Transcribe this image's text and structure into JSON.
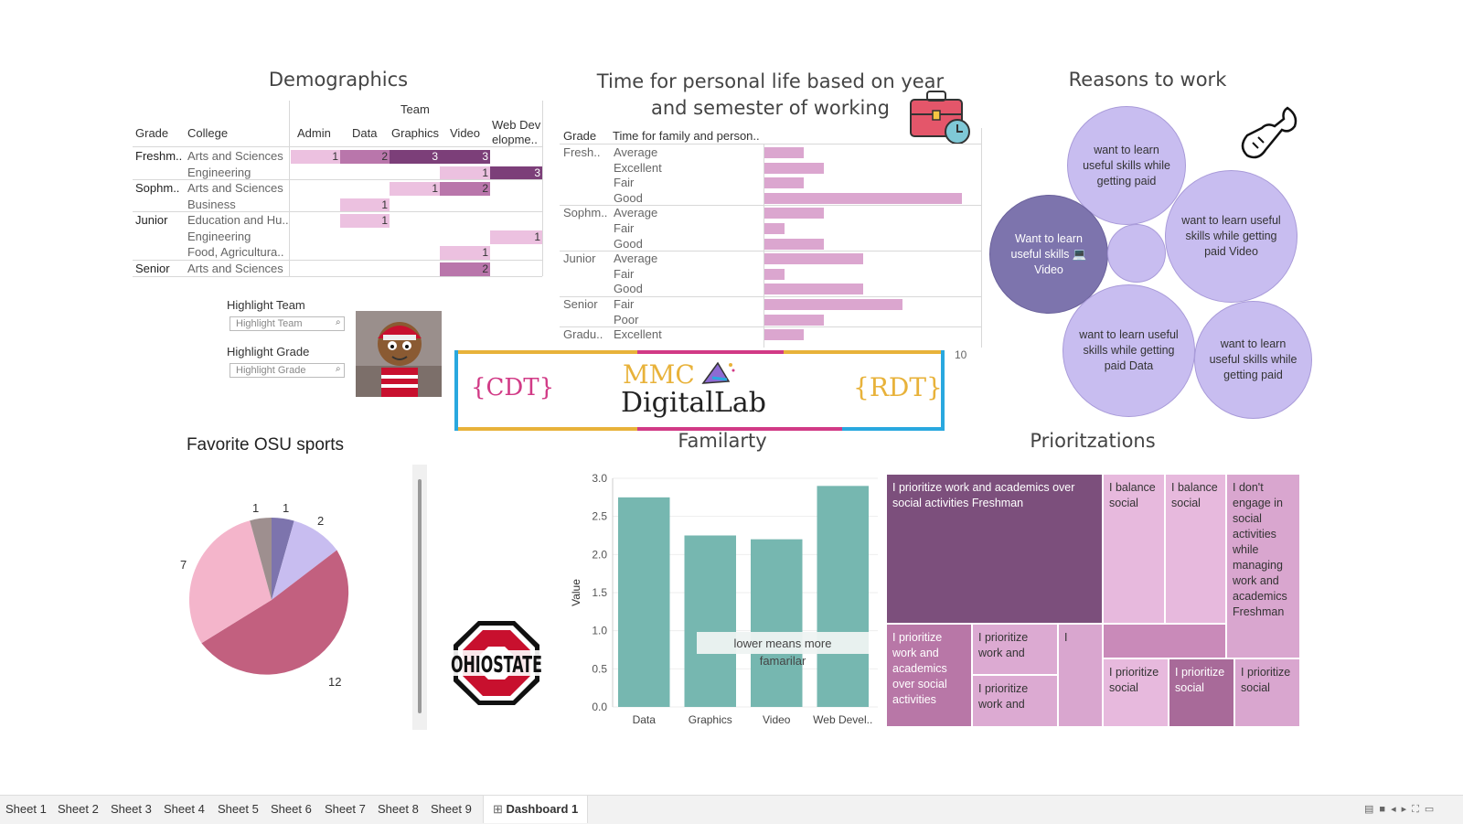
{
  "demographics": {
    "title": "Demographics",
    "team_header": "Team",
    "grade_header": "Grade",
    "college_header": "College",
    "teams": [
      "Admin",
      "Data",
      "Graphics",
      "Video",
      "Web Dev elopme.."
    ],
    "rows": [
      {
        "grade": "Freshm..",
        "college": "Arts and Sciences",
        "values": [
          1,
          2,
          3,
          3,
          null
        ]
      },
      {
        "grade": "",
        "college": "Engineering",
        "values": [
          null,
          null,
          null,
          1,
          3
        ]
      },
      {
        "grade": "Sophm..",
        "college": "Arts and Sciences",
        "values": [
          null,
          null,
          1,
          2,
          null
        ]
      },
      {
        "grade": "",
        "college": "Business",
        "values": [
          null,
          1,
          null,
          null,
          null
        ]
      },
      {
        "grade": "Junior",
        "college": "Education and Hu..",
        "values": [
          null,
          1,
          null,
          null,
          null
        ]
      },
      {
        "grade": "",
        "college": "Engineering",
        "values": [
          null,
          null,
          null,
          null,
          1
        ]
      },
      {
        "grade": "",
        "college": "Food, Agricultura..",
        "values": [
          null,
          null,
          null,
          1,
          null
        ]
      },
      {
        "grade": "Senior",
        "college": "Arts and Sciences",
        "values": [
          null,
          null,
          null,
          2,
          null
        ]
      }
    ]
  },
  "filters": {
    "team_label": "Highlight Team",
    "team_placeholder": "Highlight Team",
    "grade_label": "Highlight Grade",
    "grade_placeholder": "Highlight Grade"
  },
  "personal_time": {
    "title": "Time for personal life based on year and semester of working",
    "grade_header": "Grade",
    "time_header": "Time for family and person..",
    "axis_tick": "10",
    "rows": [
      {
        "grade": "Fresh..",
        "label": "Average",
        "value": 2
      },
      {
        "grade": "",
        "label": "Excellent",
        "value": 3
      },
      {
        "grade": "",
        "label": "Fair",
        "value": 2
      },
      {
        "grade": "",
        "label": "Good",
        "value": 10
      },
      {
        "grade": "Sophm..",
        "label": "Average",
        "value": 3
      },
      {
        "grade": "",
        "label": "Fair",
        "value": 1
      },
      {
        "grade": "",
        "label": "Good",
        "value": 3
      },
      {
        "grade": "Junior",
        "label": "Average",
        "value": 5
      },
      {
        "grade": "",
        "label": "Fair",
        "value": 1
      },
      {
        "grade": "",
        "label": "Good",
        "value": 5
      },
      {
        "grade": "Senior",
        "label": "Fair",
        "value": 7
      },
      {
        "grade": "",
        "label": "Poor",
        "value": 3
      },
      {
        "grade": "Gradu..",
        "label": "Excellent",
        "value": 2
      }
    ]
  },
  "logo": {
    "cdt": "{CDT}",
    "mmc": "MMC",
    "digital_lab": "DigitalLab",
    "rdt": "{RDT}"
  },
  "reasons": {
    "title": "Reasons to work",
    "bubbles": [
      "want to learn useful skills while getting paid",
      "Want to learn useful skills 💻 Video",
      "want to learn useful skills while getting paid Video",
      "want to learn useful skills while getting paid Data",
      "want to learn useful skills while getting paid"
    ]
  },
  "sports": {
    "title": "Favorite OSU sports",
    "labels": [
      "1",
      "1",
      "2",
      "7",
      "12"
    ]
  },
  "familiarity": {
    "title": "Familarty",
    "ylabel": "Value",
    "annotation": "lower means more famarilar",
    "colors": {
      "bar": "#76b7b0"
    }
  },
  "chart_data": {
    "type": "bar",
    "categories": [
      "Data",
      "Graphics",
      "Video",
      "Web Devel.."
    ],
    "values": [
      2.75,
      2.25,
      2.2,
      2.9
    ],
    "title": "Familarty",
    "xlabel": "",
    "ylabel": "Value",
    "ylim": [
      0,
      3.0
    ],
    "yticks": [
      "0.0",
      "0.5",
      "1.0",
      "1.5",
      "2.0",
      "2.5",
      "3.0"
    ]
  },
  "prioritizations": {
    "title": "Prioritzations",
    "cells": [
      "I prioritize work and academics over social activities Freshman",
      "I balance social",
      "I balance social",
      "I don't engage in social activities while managing work and academics Freshman",
      "I prioritize work and academics over social activities",
      "I prioritize work and",
      "I",
      "I prioritize work and",
      "I prioritize social",
      "I prioritize social",
      "I prioritize social"
    ]
  },
  "tabs": {
    "items": [
      "Sheet 1",
      "Sheet 2",
      "Sheet 3",
      "Sheet 4",
      "Sheet 5",
      "Sheet 6",
      "Sheet 7",
      "Sheet 8",
      "Sheet 9",
      "Dashboard 1"
    ],
    "active": "Dashboard 1"
  }
}
